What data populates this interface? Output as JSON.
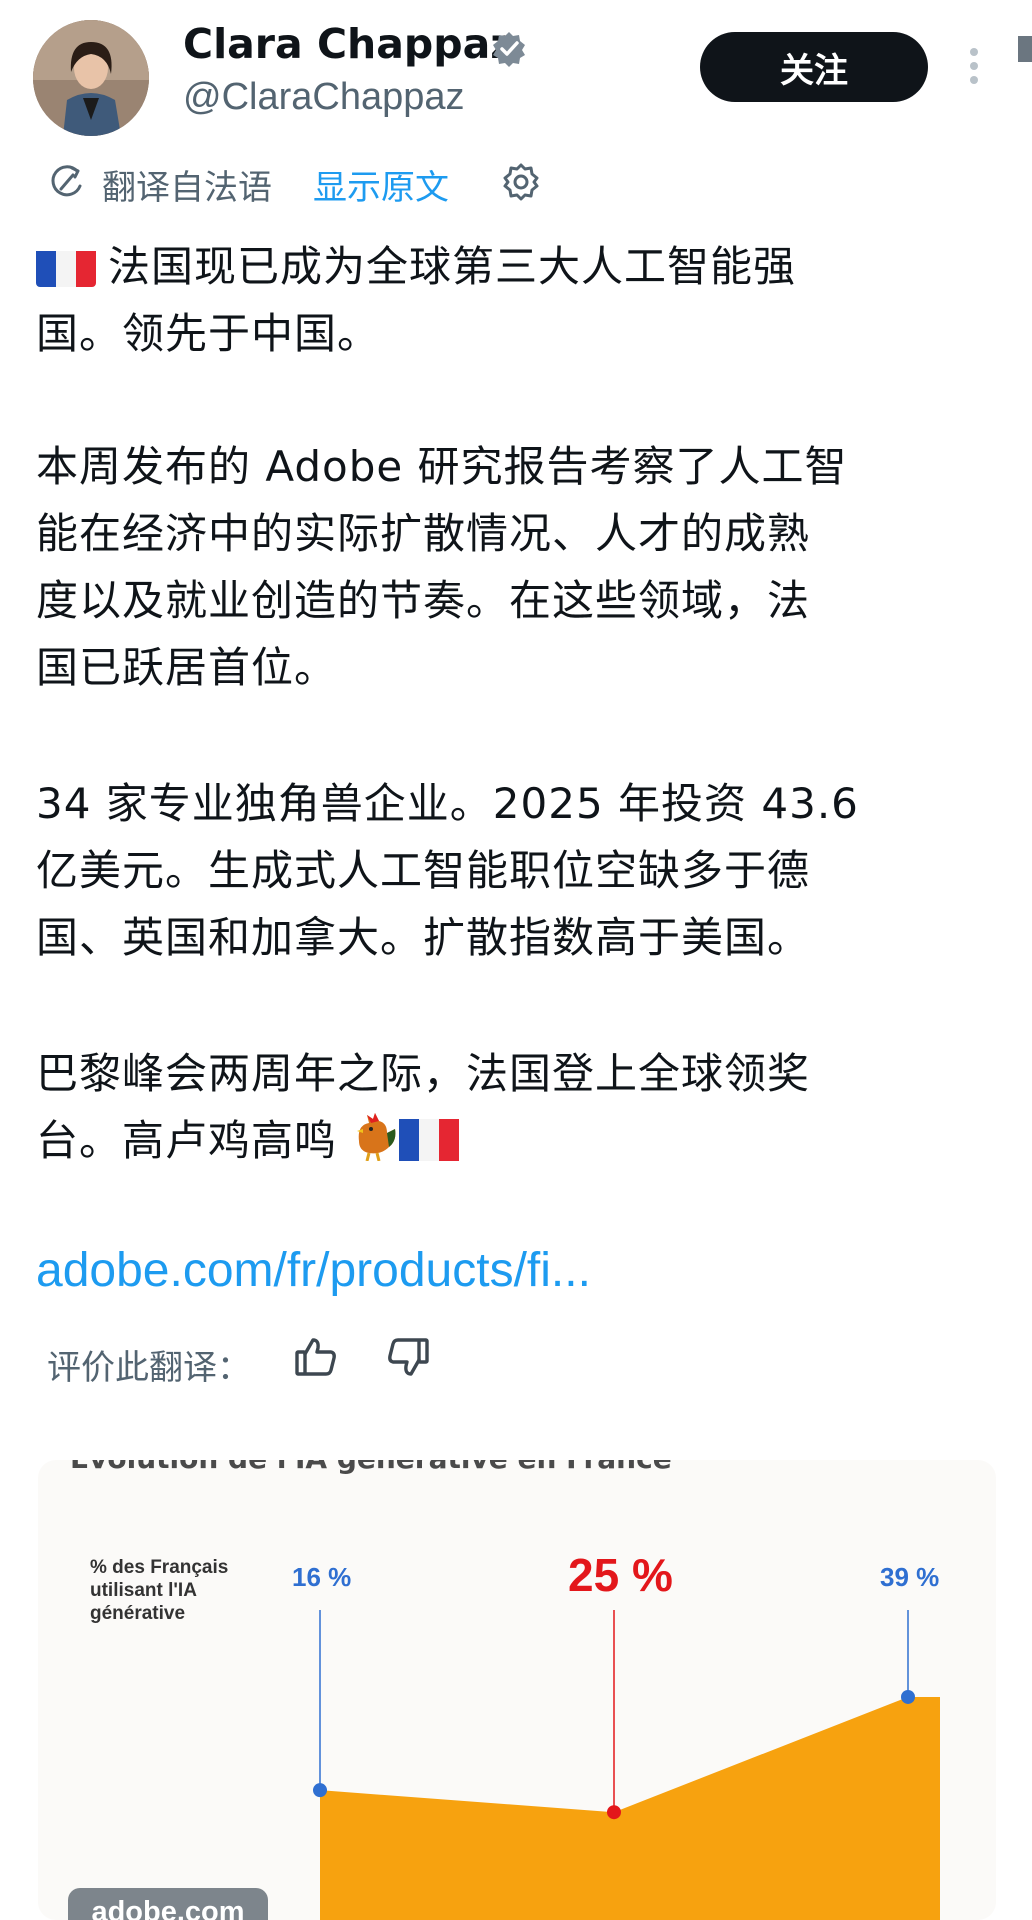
{
  "header": {
    "display_name": "Clara Chappaz",
    "handle": "@ClaraChappaz",
    "follow_label": "关注"
  },
  "translation": {
    "translated_from": "翻译自法语",
    "show_original": "显示原文"
  },
  "post": {
    "p1": [
      "法国现已成为全球第三大人工智能强",
      "国。领先于中国。"
    ],
    "p2": [
      "本周发布的 Adobe 研究报告考察了人工智",
      "能在经济中的实际扩散情况、人才的成熟",
      "度以及就业创造的节奏。在这些领域，法",
      "国已跃居首位。"
    ],
    "p3": [
      "34 家专业独角兽企业。2025 年投资 43.6",
      "亿美元。生成式人工智能职位空缺多于德",
      "国、英国和加拿大。扩散指数高于美国。"
    ],
    "p4": [
      "巴黎峰会两周年之际，法国登上全球领奖",
      "台。高卢鸡高鸣"
    ],
    "link": "adobe.com/fr/products/fi...",
    "rate_label": "评价此翻译："
  },
  "media": {
    "clipped_title": "Évolution de l'IA générative en France",
    "watermark": "adobe.com",
    "chart_data": {
      "type": "area",
      "title": "",
      "ylabel": "% des Français utilisant l'IA générative",
      "x": [
        "",
        "",
        ""
      ],
      "values": [
        16,
        25,
        39
      ],
      "value_labels": [
        "16 %",
        "25 %",
        "39 %"
      ],
      "color": "#f7a20f",
      "highlight_color": "#e3171b",
      "marker_color": "#2f6fd1"
    }
  },
  "colors": {
    "accent": "#1d9bf0",
    "text": "#0f1419",
    "muted": "#536471"
  }
}
